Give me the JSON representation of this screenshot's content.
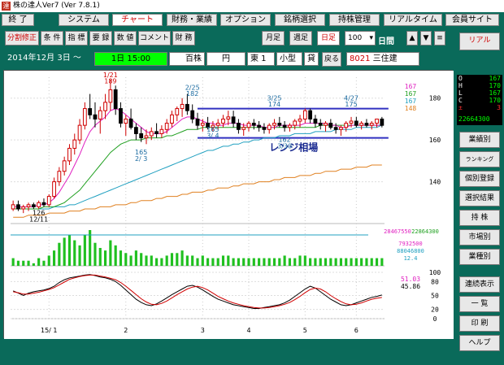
{
  "window": {
    "title": "株の達人Ver7 (Ver 7.8.1)",
    "icon_char": "達"
  },
  "menu": [
    {
      "label": "終 了"
    },
    {
      "label": "システム"
    },
    {
      "label": "チャート",
      "active": true
    },
    {
      "label": "財務・業績"
    },
    {
      "label": "オプション"
    },
    {
      "label": "銘柄選択"
    },
    {
      "label": "持株管理"
    },
    {
      "label": "リアルタイム"
    },
    {
      "label": "会員サイト"
    }
  ],
  "toolbar": {
    "left": [
      "分割修正",
      "条 件",
      "指 標",
      "要 録",
      "数 値",
      "コメント",
      "財 務"
    ],
    "period": [
      "月足",
      "週足",
      "日足"
    ],
    "count_value": "100",
    "unit_label": "日間",
    "arrows": [
      "▲",
      "▼",
      "≡"
    ]
  },
  "info": {
    "date": "2014年12月 3日",
    "tilde": "〜",
    "time": "1日 15:00",
    "unit": "百株",
    "currency": "円",
    "market": "東 1",
    "size": "小型",
    "type": "貸",
    "back": "戻る",
    "code": "8021",
    "name": "三住建"
  },
  "chart_data": {
    "type": "line",
    "title": "",
    "xlabel": "",
    "ylabel": "",
    "x_ticks": [
      "15/ 1",
      "2",
      "3",
      "4",
      "5",
      "6"
    ],
    "ylim": [
      120,
      190
    ],
    "y_ticks": [
      140,
      160,
      180
    ],
    "right_values": [
      "167",
      "167",
      "167",
      "148"
    ],
    "annotations": [
      {
        "text": "1/21",
        "x": "1/21",
        "y": 190
      },
      {
        "text": "189",
        "x": "1/21",
        "y": 187
      },
      {
        "text": "2/25",
        "x": "2/25",
        "y": 184
      },
      {
        "text": "182",
        "x": "2/25",
        "y": 181
      },
      {
        "text": "3/25",
        "x": "3/25",
        "y": 179
      },
      {
        "text": "174",
        "x": "3/25",
        "y": 176
      },
      {
        "text": "4/27",
        "x": "4/27",
        "y": 179
      },
      {
        "text": "175",
        "x": "4/27",
        "y": 176
      },
      {
        "text": "165",
        "x": "2/3",
        "y": 153
      },
      {
        "text": "2/ 3",
        "x": "2/3",
        "y": 150
      },
      {
        "text": "165",
        "x": "3/4",
        "y": 164
      },
      {
        "text": "3/ 4",
        "x": "3/4",
        "y": 161
      },
      {
        "text": "162",
        "x": "3/30",
        "y": 159
      },
      {
        "text": "3/30",
        "x": "3/30",
        "y": 156
      },
      {
        "text": "126",
        "x": "12/11",
        "y": 124
      },
      {
        "text": "12/11",
        "x": "12/11",
        "y": 121
      }
    ],
    "range_label": "レンジ相場",
    "candles": [
      [
        127,
        131,
        126,
        129
      ],
      [
        129,
        131,
        126,
        127
      ],
      [
        127,
        129,
        125,
        128
      ],
      [
        128,
        130,
        126,
        129
      ],
      [
        129,
        130,
        127,
        128
      ],
      [
        128,
        131,
        127,
        130
      ],
      [
        130,
        132,
        128,
        129
      ],
      [
        129,
        134,
        128,
        133
      ],
      [
        133,
        142,
        132,
        140
      ],
      [
        140,
        147,
        138,
        145
      ],
      [
        145,
        152,
        143,
        150
      ],
      [
        150,
        158,
        148,
        156
      ],
      [
        156,
        163,
        153,
        160
      ],
      [
        160,
        170,
        158,
        167
      ],
      [
        167,
        178,
        165,
        175
      ],
      [
        175,
        182,
        170,
        172
      ],
      [
        172,
        178,
        166,
        170
      ],
      [
        170,
        176,
        163,
        174
      ],
      [
        174,
        182,
        170,
        178
      ],
      [
        178,
        189,
        174,
        184
      ],
      [
        184,
        186,
        172,
        175
      ],
      [
        175,
        178,
        166,
        168
      ],
      [
        168,
        172,
        162,
        170
      ],
      [
        170,
        175,
        165,
        166
      ],
      [
        166,
        168,
        160,
        163
      ],
      [
        163,
        166,
        159,
        161
      ],
      [
        161,
        165,
        158,
        162
      ],
      [
        162,
        166,
        160,
        164
      ],
      [
        164,
        168,
        161,
        163
      ],
      [
        163,
        167,
        161,
        165
      ],
      [
        165,
        170,
        163,
        168
      ],
      [
        168,
        174,
        166,
        172
      ],
      [
        172,
        176,
        169,
        175
      ],
      [
        175,
        180,
        171,
        177
      ],
      [
        177,
        182,
        172,
        174
      ],
      [
        174,
        177,
        168,
        170
      ],
      [
        170,
        173,
        165,
        167
      ],
      [
        167,
        170,
        164,
        168
      ],
      [
        168,
        171,
        165,
        166
      ],
      [
        166,
        169,
        164,
        167
      ],
      [
        167,
        170,
        165,
        168
      ],
      [
        168,
        172,
        166,
        170
      ],
      [
        170,
        174,
        167,
        171
      ],
      [
        171,
        174,
        166,
        168
      ],
      [
        168,
        170,
        163,
        165
      ],
      [
        165,
        168,
        162,
        166
      ],
      [
        166,
        169,
        164,
        168
      ],
      [
        168,
        170,
        165,
        167
      ],
      [
        167,
        169,
        164,
        166
      ],
      [
        166,
        168,
        163,
        165
      ],
      [
        165,
        168,
        163,
        167
      ],
      [
        167,
        170,
        165,
        168
      ],
      [
        168,
        171,
        166,
        167
      ],
      [
        167,
        169,
        164,
        166
      ],
      [
        166,
        168,
        164,
        167
      ],
      [
        167,
        170,
        165,
        169
      ],
      [
        169,
        172,
        166,
        170
      ],
      [
        170,
        175,
        168,
        174
      ],
      [
        174,
        175,
        168,
        170
      ],
      [
        170,
        172,
        166,
        168
      ],
      [
        168,
        170,
        165,
        167
      ],
      [
        167,
        169,
        164,
        168
      ],
      [
        168,
        170,
        165,
        166
      ],
      [
        166,
        168,
        163,
        165
      ],
      [
        165,
        167,
        162,
        166
      ],
      [
        166,
        169,
        164,
        168
      ],
      [
        168,
        171,
        166,
        169
      ],
      [
        169,
        171,
        166,
        167
      ],
      [
        167,
        169,
        165,
        168
      ],
      [
        168,
        170,
        166,
        167
      ],
      [
        167,
        169,
        165,
        168
      ],
      [
        168,
        170,
        166,
        170
      ],
      [
        170,
        171,
        166,
        167
      ]
    ],
    "ma_short": [
      128,
      128,
      128,
      128,
      128,
      129,
      129,
      130,
      132,
      135,
      139,
      143,
      148,
      153,
      159,
      164,
      167,
      169,
      171,
      174,
      175,
      174,
      172,
      170,
      168,
      166,
      164,
      163,
      163,
      163,
      164,
      166,
      168,
      170,
      171,
      171,
      170,
      169,
      168,
      168,
      167,
      167,
      168,
      168,
      168,
      167,
      167,
      167,
      167,
      166,
      166,
      166,
      167,
      167,
      167,
      167,
      167,
      168,
      168,
      168,
      168,
      168,
      167,
      167,
      166,
      166,
      167,
      167,
      167,
      167,
      167,
      167,
      167
    ],
    "ma_mid": [
      127,
      127,
      127,
      127,
      127,
      127,
      128,
      128,
      128,
      129,
      130,
      132,
      134,
      136,
      139,
      142,
      145,
      148,
      151,
      154,
      156,
      158,
      159,
      160,
      160,
      160,
      161,
      161,
      161,
      161,
      162,
      162,
      163,
      164,
      165,
      165,
      165,
      166,
      166,
      166,
      166,
      166,
      166,
      166,
      166,
      166,
      166,
      166,
      166,
      166,
      166,
      166,
      166,
      166,
      166,
      166,
      166,
      166,
      166,
      166,
      167,
      167,
      167,
      167,
      167,
      167,
      167,
      167,
      167,
      167,
      167,
      167,
      167
    ],
    "ma_long": [
      127,
      127,
      127,
      127,
      127,
      127,
      127,
      127,
      128,
      128,
      128,
      129,
      129,
      130,
      131,
      132,
      133,
      134,
      135,
      136,
      137,
      138,
      139,
      140,
      141,
      142,
      143,
      144,
      145,
      146,
      147,
      148,
      149,
      150,
      151,
      152,
      153,
      154,
      155,
      155,
      156,
      157,
      157,
      158,
      158,
      159,
      159,
      160,
      160,
      161,
      161,
      161,
      162,
      162,
      162,
      163,
      163,
      163,
      163,
      164,
      164,
      164,
      164,
      165,
      165,
      165,
      165,
      166,
      166,
      166,
      166,
      166,
      167
    ],
    "ma_xlong": [
      123,
      123,
      123,
      124,
      124,
      124,
      124,
      125,
      125,
      125,
      125,
      126,
      126,
      126,
      127,
      127,
      127,
      128,
      128,
      128,
      129,
      129,
      129,
      130,
      130,
      131,
      131,
      131,
      132,
      132,
      133,
      133,
      133,
      134,
      134,
      135,
      135,
      135,
      136,
      136,
      137,
      137,
      137,
      138,
      138,
      139,
      139,
      139,
      140,
      140,
      140,
      141,
      141,
      142,
      142,
      142,
      143,
      143,
      143,
      144,
      144,
      145,
      145,
      145,
      146,
      146,
      146,
      147,
      147,
      147,
      148,
      148,
      148
    ],
    "range_band": {
      "top": 175,
      "bottom": 161
    },
    "volume_labels": [
      "28467550",
      "22864300",
      "7932500",
      "88046800",
      "12.4"
    ],
    "volume": [
      3,
      2,
      2,
      2,
      1,
      3,
      2,
      4,
      6,
      9,
      11,
      12,
      10,
      8,
      12,
      14,
      9,
      7,
      6,
      10,
      8,
      6,
      5,
      4,
      6,
      5,
      4,
      4,
      3,
      3,
      4,
      5,
      5,
      6,
      4,
      4,
      3,
      4,
      3,
      3,
      3,
      4,
      4,
      3,
      3,
      3,
      3,
      3,
      3,
      3,
      3,
      3,
      3,
      4,
      3,
      3,
      4,
      4,
      3,
      3,
      3,
      3,
      3,
      3,
      3,
      3,
      3,
      3,
      3,
      3,
      3,
      3,
      3
    ],
    "osc_labels": [
      "51.03",
      "45.86"
    ],
    "osc_ticks": [
      100,
      80,
      50,
      20,
      0
    ],
    "osc_k": [
      60,
      55,
      50,
      55,
      58,
      60,
      62,
      65,
      70,
      78,
      84,
      88,
      90,
      92,
      94,
      95,
      93,
      90,
      88,
      85,
      80,
      72,
      62,
      52,
      42,
      35,
      30,
      28,
      32,
      38,
      45,
      52,
      58,
      64,
      70,
      72,
      68,
      62,
      55,
      48,
      42,
      38,
      34,
      30,
      28,
      26,
      24,
      22,
      22,
      24,
      26,
      28,
      30,
      34,
      40,
      48,
      56,
      64,
      70,
      66,
      58,
      50,
      42,
      36,
      30,
      28,
      30,
      34,
      38,
      42,
      46,
      48,
      51
    ],
    "osc_d": [
      58,
      56,
      53,
      53,
      55,
      57,
      60,
      63,
      67,
      73,
      79,
      85,
      88,
      91,
      93,
      94,
      94,
      92,
      90,
      87,
      84,
      78,
      70,
      61,
      52,
      43,
      36,
      31,
      30,
      33,
      38,
      45,
      52,
      58,
      64,
      68,
      70,
      67,
      62,
      55,
      48,
      43,
      38,
      34,
      31,
      28,
      26,
      24,
      23,
      23,
      24,
      26,
      28,
      31,
      35,
      41,
      48,
      56,
      63,
      66,
      64,
      58,
      50,
      43,
      37,
      32,
      30,
      31,
      34,
      38,
      42,
      44,
      45.86
    ]
  },
  "right_panel": {
    "top_button": "リアル",
    "quote": [
      {
        "k": "O",
        "v": "167"
      },
      {
        "k": "H",
        "v": "170"
      },
      {
        "k": "L",
        "v": "167"
      },
      {
        "k": "C",
        "v": "170"
      },
      {
        "k": "±",
        "v": "3"
      }
    ],
    "quote_total": "22664300",
    "buttons": [
      "業績別",
      "ランキング",
      "個別登録",
      "選択結果",
      "持 株",
      "市場別",
      "業種別",
      "連続表示",
      "一 覧",
      "印 刷",
      "ヘルプ"
    ]
  }
}
